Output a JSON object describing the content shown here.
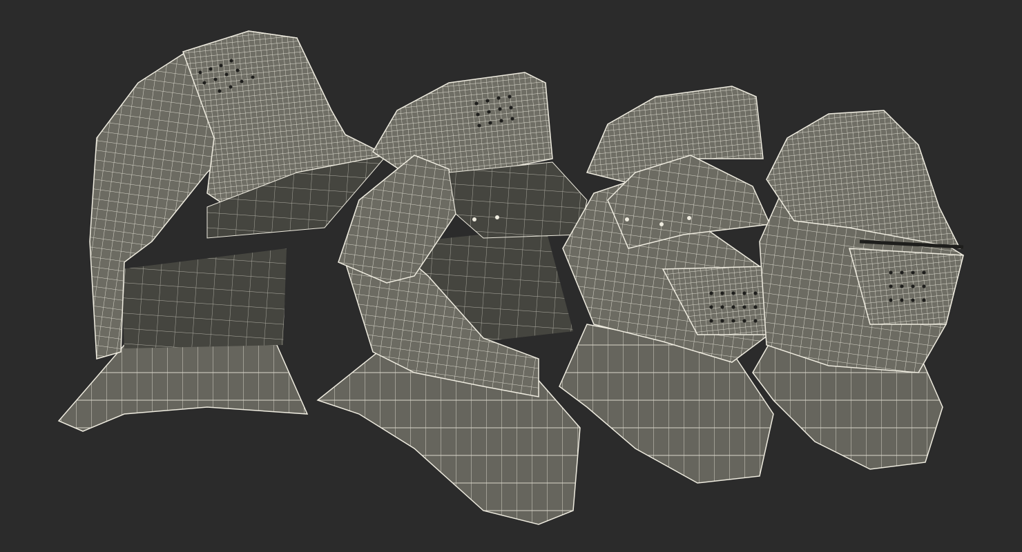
{
  "scene": {
    "background": "#2b2b2b",
    "helmet_fill": "#6c6b62",
    "helmet_shadow": "#4a4a43",
    "helmet_dark": "#383834",
    "wire_color": "#efece0",
    "helmets": [
      {
        "name": "helmet-1"
      },
      {
        "name": "helmet-2"
      },
      {
        "name": "helmet-3"
      },
      {
        "name": "helmet-4"
      }
    ]
  }
}
